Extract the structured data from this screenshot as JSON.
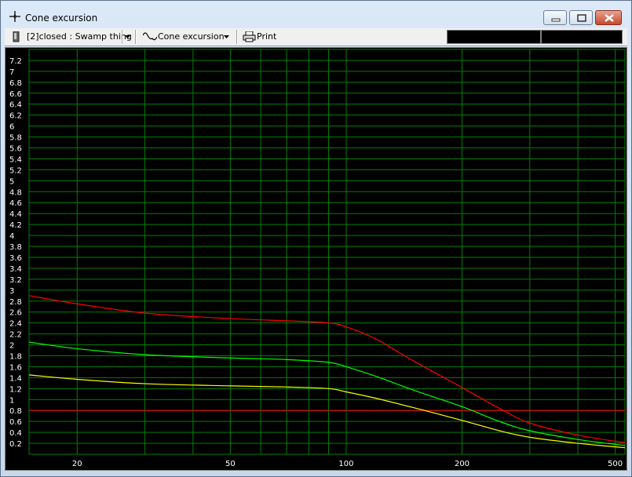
{
  "window": {
    "title": "Cone excursion"
  },
  "toolbar": {
    "project_label": "[2]closed : Swamp thing",
    "view_label": "Cone excursion",
    "print_label": "Print"
  },
  "colors": {
    "background": "#000000",
    "grid": "#008000",
    "axis_text": "#ffffff"
  },
  "chart_data": {
    "type": "line",
    "title": "",
    "xlabel": "",
    "ylabel": "",
    "x_scale": "log",
    "xlim": [
      15,
      530
    ],
    "ylim": [
      0,
      7.4
    ],
    "grid": true,
    "x_ticks": [
      20,
      50,
      100,
      200,
      500
    ],
    "y_ticks": [
      0.2,
      0.4,
      0.6,
      0.8,
      1,
      1.2,
      1.4,
      1.6,
      1.8,
      2,
      2.2,
      2.4,
      2.6,
      2.8,
      3,
      3.2,
      3.4,
      3.6,
      3.8,
      4,
      4.2,
      4.4,
      4.6,
      4.8,
      5,
      5.2,
      5.4,
      5.6,
      5.8,
      6,
      6.2,
      6.4,
      6.6,
      6.8,
      7,
      7.2
    ],
    "hlines": [
      {
        "y": 0.8,
        "color": "#ff0000"
      }
    ],
    "series": [
      {
        "color": "#ff0000",
        "x": [
          15,
          20,
          30,
          50,
          70,
          90,
          100,
          120,
          150,
          200,
          250,
          300,
          400,
          530
        ],
        "y": [
          2.9,
          2.75,
          2.58,
          2.48,
          2.44,
          2.4,
          2.33,
          2.1,
          1.7,
          1.22,
          0.84,
          0.57,
          0.35,
          0.21
        ]
      },
      {
        "color": "#00ff00",
        "x": [
          15,
          20,
          30,
          50,
          70,
          90,
          100,
          120,
          150,
          200,
          250,
          300,
          400,
          530
        ],
        "y": [
          2.05,
          1.93,
          1.82,
          1.76,
          1.73,
          1.68,
          1.6,
          1.42,
          1.17,
          0.87,
          0.6,
          0.43,
          0.27,
          0.16
        ]
      },
      {
        "color": "#ffff00",
        "x": [
          15,
          20,
          30,
          50,
          70,
          90,
          100,
          120,
          150,
          200,
          250,
          300,
          400,
          530
        ],
        "y": [
          1.45,
          1.37,
          1.29,
          1.25,
          1.23,
          1.2,
          1.14,
          1.02,
          0.85,
          0.62,
          0.43,
          0.31,
          0.2,
          0.12
        ]
      }
    ]
  }
}
